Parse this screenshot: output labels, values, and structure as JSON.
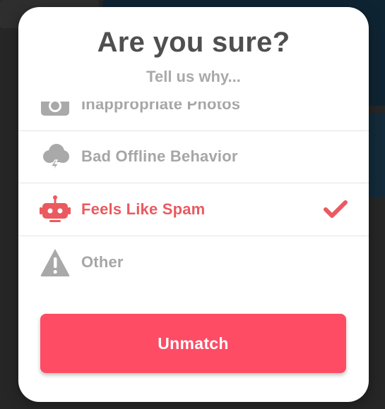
{
  "dialog": {
    "title": "Are you sure?",
    "subtitle": "Tell us why..."
  },
  "options": [
    {
      "label": "Inappropriate Photos",
      "icon": "camera-icon",
      "selected": false
    },
    {
      "label": "Bad Offline Behavior",
      "icon": "storm-cloud-icon",
      "selected": false
    },
    {
      "label": "Feels Like Spam",
      "icon": "robot-icon",
      "selected": true
    },
    {
      "label": "Other",
      "icon": "warning-icon",
      "selected": false
    }
  ],
  "selected_check_icon": "checkmark-icon",
  "actions": {
    "unmatch_label": "Unmatch"
  },
  "colors": {
    "accent": "#fe4c65",
    "selected_text": "#ea5a60",
    "muted_text": "#a6a6a6",
    "title_text": "#4f4f4f"
  }
}
